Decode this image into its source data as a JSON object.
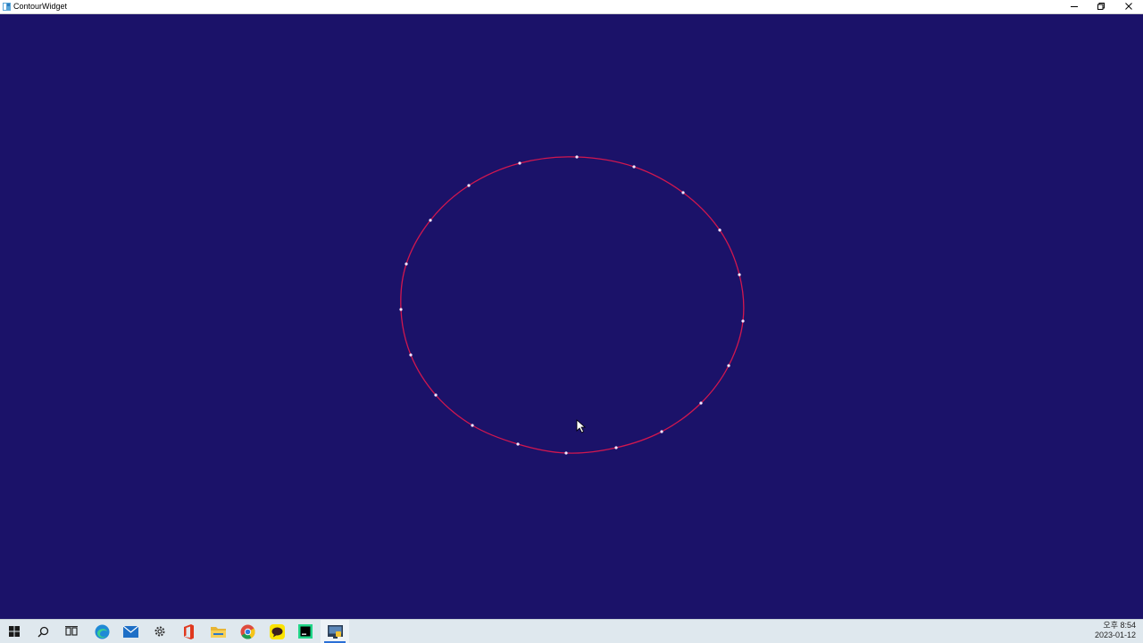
{
  "window": {
    "title": "ContourWidget",
    "app_icon": "qt-app-icon",
    "controls": [
      "minimize-icon",
      "restore-icon",
      "close-icon"
    ]
  },
  "canvas": {
    "background_color": "#1b1269",
    "contour_color": "#d1174f",
    "point_color": "#f5e6ff",
    "contour_points": 20
  },
  "taskbar": {
    "items": [
      {
        "name": "start",
        "icon": "windows-logo-icon"
      },
      {
        "name": "search",
        "icon": "search-icon"
      },
      {
        "name": "task-view",
        "icon": "task-view-icon"
      },
      {
        "name": "edge",
        "icon": "edge-icon"
      },
      {
        "name": "mail",
        "icon": "mail-icon"
      },
      {
        "name": "settings",
        "icon": "gear-icon"
      },
      {
        "name": "office",
        "icon": "office-icon"
      },
      {
        "name": "file-explorer",
        "icon": "folder-icon"
      },
      {
        "name": "chrome",
        "icon": "chrome-icon"
      },
      {
        "name": "kakaotalk",
        "icon": "kakaotalk-icon"
      },
      {
        "name": "pycharm",
        "icon": "pycharm-icon"
      },
      {
        "name": "contour-widget",
        "icon": "python-app-icon",
        "active": true
      }
    ],
    "clock": {
      "time": "오후 8:54",
      "date": "2023-01-12"
    }
  }
}
